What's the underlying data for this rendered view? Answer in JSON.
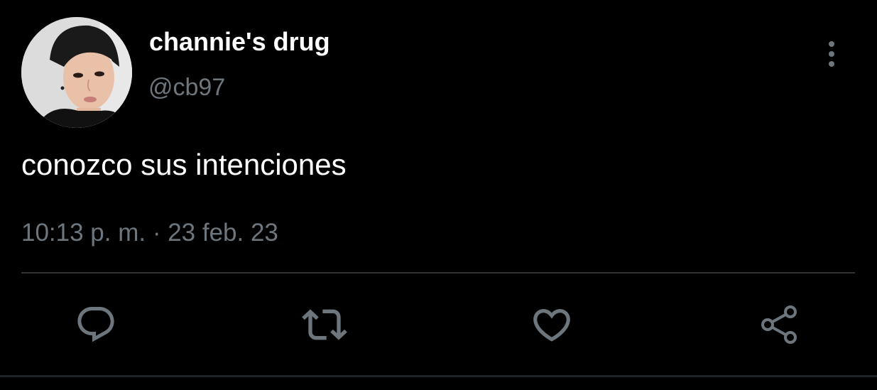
{
  "tweet": {
    "display_name": "channie's drug",
    "handle": "@cb97",
    "text": "conozco sus intenciones",
    "timestamp": "10:13 p. m. · 23 feb. 23"
  },
  "icons": {
    "more": "more-vertical-icon",
    "reply": "reply-icon",
    "retweet": "retweet-icon",
    "like": "heart-icon",
    "share": "share-icon"
  },
  "colors": {
    "background": "#000000",
    "primary_text": "#ffffff",
    "secondary_text": "#6e767d",
    "divider": "#2f3336",
    "icon": "#6e767d"
  }
}
